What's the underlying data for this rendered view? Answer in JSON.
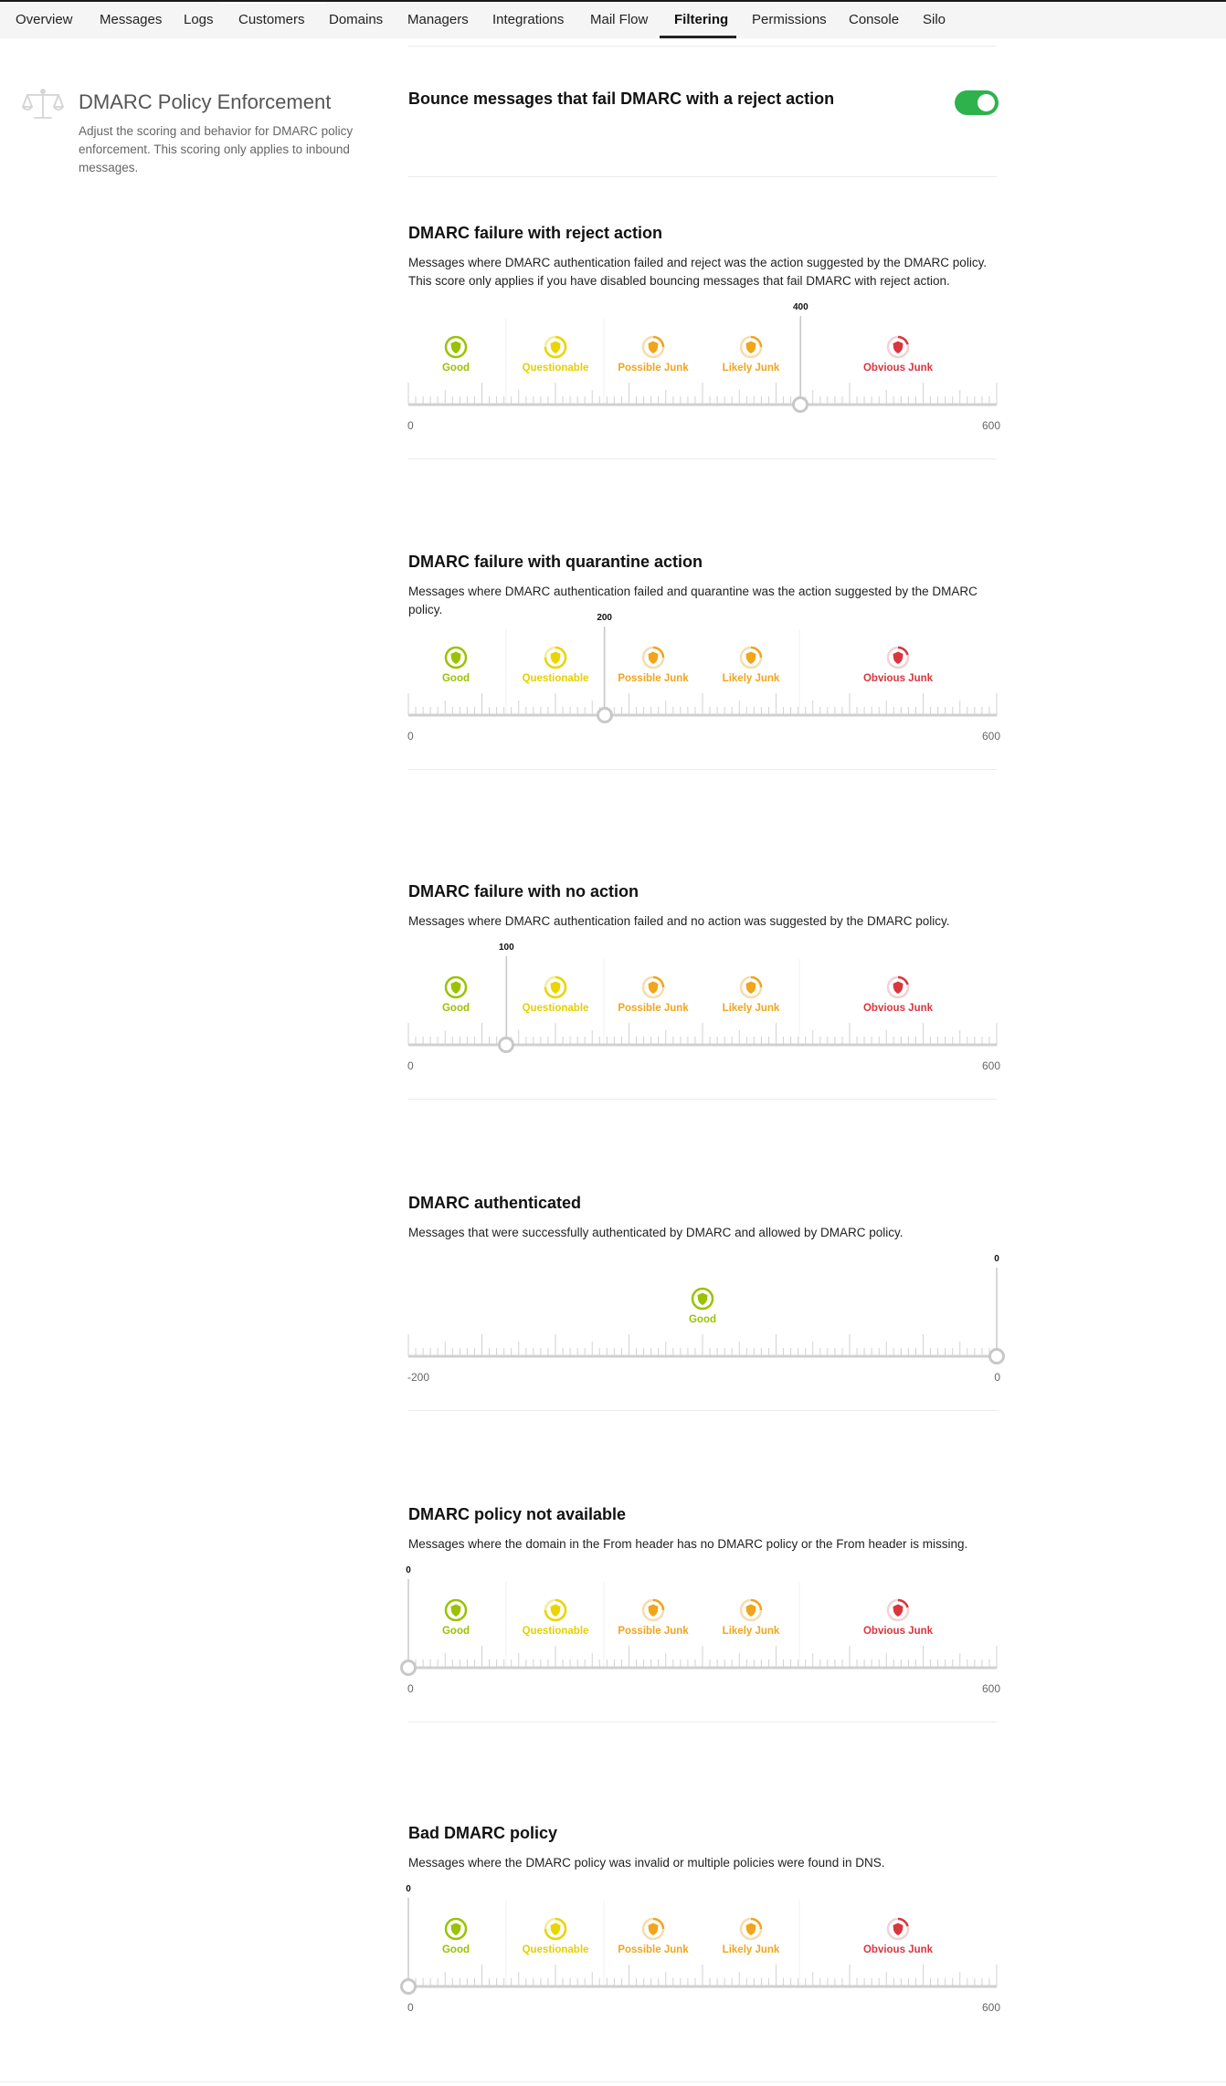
{
  "nav": {
    "tabs": [
      {
        "label": "Overview",
        "active": false
      },
      {
        "label": "Messages",
        "active": false
      },
      {
        "label": "Logs",
        "active": false
      },
      {
        "label": "Customers",
        "active": false
      },
      {
        "label": "Domains",
        "active": false
      },
      {
        "label": "Managers",
        "active": false
      },
      {
        "label": "Integrations",
        "active": false
      },
      {
        "label": "Mail Flow",
        "active": false
      },
      {
        "label": "Filtering",
        "active": true
      },
      {
        "label": "Permissions",
        "active": false
      },
      {
        "label": "Console",
        "active": false
      },
      {
        "label": "Silo",
        "active": false
      }
    ]
  },
  "section": {
    "icon": "scale-icon",
    "title": "DMARC Policy Enforcement",
    "description": "Adjust the scoring and behavior for DMARC policy enforcement. This scoring only applies to inbound messages."
  },
  "bounce": {
    "label": "Bounce messages that fail DMARC with a reject action",
    "enabled": true
  },
  "colors": {
    "good": "#9ac200",
    "questionable": "#e9d500",
    "possible_junk": "#f0a51c",
    "likely_junk": "#f0a51c",
    "obvious_junk": "#d9363e",
    "toggle_on": "#2eb24b"
  },
  "categories": [
    {
      "key": "good",
      "label": "Good",
      "icon": "shield-good-icon"
    },
    {
      "key": "questionable",
      "label": "Questionable",
      "icon": "shield-questionable-icon"
    },
    {
      "key": "possible_junk",
      "label": "Possible Junk",
      "icon": "shield-possible-junk-icon"
    },
    {
      "key": "likely_junk",
      "label": "Likely Junk",
      "icon": "shield-likely-junk-icon"
    },
    {
      "key": "obvious_junk",
      "label": "Obvious Junk",
      "icon": "shield-obvious-junk-icon"
    }
  ],
  "cards": [
    {
      "title": "DMARC failure with reject action",
      "description": "Messages where DMARC authentication failed and reject was the action suggested by the DMARC policy. This score only applies if you have disabled bouncing messages that fail DMARC with reject action.",
      "min": 0,
      "max": 600,
      "min_label": "0",
      "max_label": "600",
      "value": 400,
      "value_label": "400",
      "scale": "full"
    },
    {
      "title": "DMARC failure with quarantine action",
      "description": "Messages where DMARC authentication failed and quarantine was the action suggested by the DMARC policy.",
      "min": 0,
      "max": 600,
      "min_label": "0",
      "max_label": "600",
      "value": 200,
      "value_label": "200",
      "scale": "full"
    },
    {
      "title": "DMARC failure with no action",
      "description": "Messages where DMARC authentication failed and no action was suggested by the DMARC policy.",
      "min": 0,
      "max": 600,
      "min_label": "0",
      "max_label": "600",
      "value": 100,
      "value_label": "100",
      "scale": "full"
    },
    {
      "title": "DMARC authenticated",
      "description": "Messages that were successfully authenticated by DMARC and allowed by DMARC policy.",
      "min": -200,
      "max": 0,
      "min_label": "-200",
      "max_label": "0",
      "value": 0,
      "value_label": "0",
      "scale": "good-only"
    },
    {
      "title": "DMARC policy not available",
      "description": "Messages where the domain in the From header has no DMARC policy or the From header is missing.",
      "min": 0,
      "max": 600,
      "min_label": "0",
      "max_label": "600",
      "value": 0,
      "value_label": "0",
      "scale": "full"
    },
    {
      "title": "Bad DMARC policy",
      "description": "Messages where the DMARC policy was invalid or multiple policies were found in DNS.",
      "min": 0,
      "max": 600,
      "min_label": "0",
      "max_label": "600",
      "value": 0,
      "value_label": "0",
      "scale": "full"
    }
  ]
}
